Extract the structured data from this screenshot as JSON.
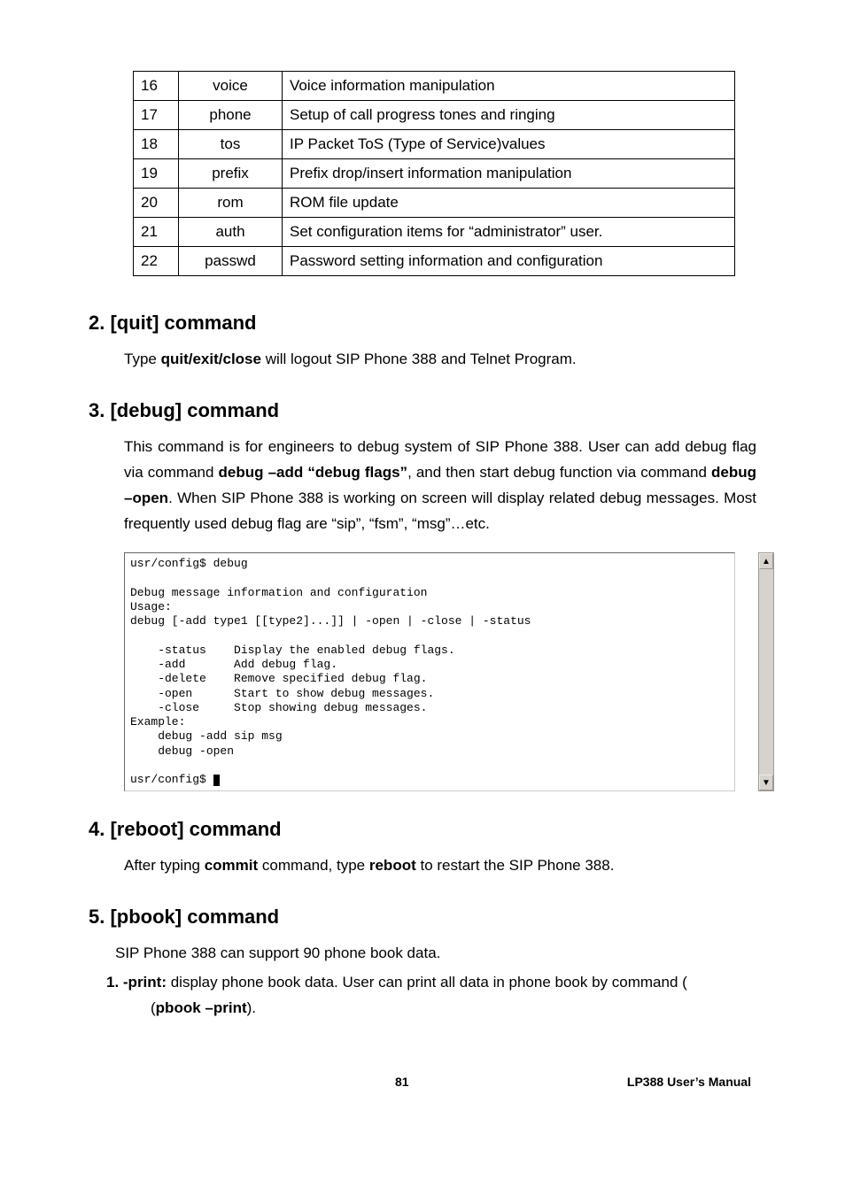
{
  "table": {
    "rows": [
      {
        "n": "16",
        "cmd": "voice",
        "desc": "Voice information manipulation"
      },
      {
        "n": "17",
        "cmd": "phone",
        "desc": "Setup of call progress tones and ringing"
      },
      {
        "n": "18",
        "cmd": "tos",
        "desc": "IP Packet ToS (Type of Service)values"
      },
      {
        "n": "19",
        "cmd": "prefix",
        "desc": "Prefix drop/insert information manipulation"
      },
      {
        "n": "20",
        "cmd": "rom",
        "desc": "ROM file update"
      },
      {
        "n": "21",
        "cmd": "auth",
        "desc": "Set configuration items for “administrator” user."
      },
      {
        "n": "22",
        "cmd": "passwd",
        "desc": "Password setting information and configuration"
      }
    ]
  },
  "sections": {
    "quit": {
      "heading": "2. [quit] command",
      "p1a": "Type ",
      "p1b": "quit/exit/close",
      "p1c": " will logout SIP Phone 388 and Telnet Program."
    },
    "debug": {
      "heading": "3. [debug] command",
      "p1a": "This command is for engineers to debug system of SIP Phone 388. User can add debug flag via command ",
      "p1b": "debug –add “debug flags”",
      "p1c": ", and then start debug function via command ",
      "p1d": "debug –open",
      "p1e": ". When SIP Phone 388 is working on screen will display related debug messages. Most frequently used debug flag are “sip”, “fsm”, “msg”…etc."
    },
    "reboot": {
      "heading": "4. [reboot] command",
      "p1a": "After typing ",
      "p1b": "commit",
      "p1c": " command, type ",
      "p1d": "reboot",
      "p1e": " to restart the SIP Phone 388."
    },
    "pbook": {
      "heading": "5. [pbook] command",
      "p1": "SIP Phone 388 can support 90 phone book data.",
      "p2a": "1. -print:",
      "p2b": " display phone book data. User can print all data in phone book by command (",
      "p2c": "pbook –print",
      "p2d": ")."
    }
  },
  "terminal": {
    "line1": "usr/config$ debug",
    "blank": "",
    "line2": "Debug message information and configuration",
    "line3": "Usage:",
    "line4": "debug [-add type1 [[type2]...]] | -open | -close | -status",
    "opt1": "    -status    Display the enabled debug flags.",
    "opt2": "    -add       Add debug flag.",
    "opt3": "    -delete    Remove specified debug flag.",
    "opt4": "    -open      Start to show debug messages.",
    "opt5": "    -close     Stop showing debug messages.",
    "ex": "Example:",
    "ex1": "    debug -add sip msg",
    "ex2": "    debug -open",
    "prompt": "usr/config$ "
  },
  "footer": {
    "page": "81",
    "manual_a": "LP388  ",
    "manual_b": "User’s  Manual"
  }
}
